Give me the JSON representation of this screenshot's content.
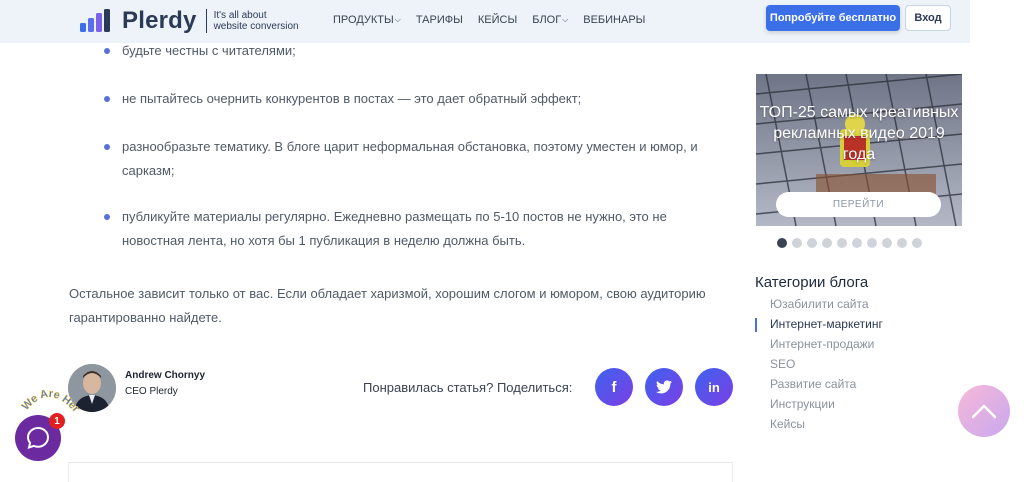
{
  "header": {
    "brand": "Plerdy",
    "tagline_line1": "It's all about",
    "tagline_line2": "website conversion",
    "nav": [
      {
        "label": "ПРОДУКТЫ",
        "has_dropdown": true
      },
      {
        "label": "ТАРИФЫ",
        "has_dropdown": false
      },
      {
        "label": "КЕЙСЫ",
        "has_dropdown": false
      },
      {
        "label": "БЛОГ",
        "has_dropdown": true
      },
      {
        "label": "ВЕБИНАРЫ",
        "has_dropdown": false
      }
    ],
    "cta_label": "Попробуйте бесплатно",
    "login_label": "Вход"
  },
  "article": {
    "bullets": [
      "будьте честны с читателями;",
      "не пытайтесь очернить конкурентов в постах — это дает обратный эффект;",
      "разнообразьте тематику. В блоге царит неформальная обстановка, поэтому уместен и юмор, и сарказм;",
      "публикуйте материалы регулярно. Ежедневно размещать по 5-10 постов не нужно, это не новостная лента, но хотя бы 1 публикация в неделю должна быть."
    ],
    "closing_paragraph": "Остальное зависит только от вас. Если обладает харизмой, хорошим слогом и юмором, свою аудиторию гарантированно найдете."
  },
  "author": {
    "name": "Andrew Chornyy",
    "role": "CEO Plerdy"
  },
  "share": {
    "label": "Понравилась статья? Поделиться:",
    "buttons": [
      {
        "icon": "facebook-icon",
        "glyph": "f"
      },
      {
        "icon": "twitter-icon",
        "glyph": ""
      },
      {
        "icon": "linkedin-icon",
        "glyph": "in"
      }
    ]
  },
  "sidebar": {
    "banner_title": "ТОП-25 самых креативных рекламных видео 2019 года",
    "banner_button": "ПЕРЕЙТИ",
    "carousel_total": 10,
    "carousel_active": 1,
    "categories_title": "Категории блога",
    "categories": [
      {
        "label": "Юзабилити сайта",
        "active": false
      },
      {
        "label": "Интернет-маркетинг",
        "active": true
      },
      {
        "label": "Интернет-продажи",
        "active": false
      },
      {
        "label": "SEO",
        "active": false
      },
      {
        "label": "Развитие сайта",
        "active": false
      },
      {
        "label": "Инструкции",
        "active": false
      },
      {
        "label": "Кейсы",
        "active": false
      }
    ]
  },
  "chat": {
    "badge_count": "1",
    "bubble_text": "We Are Here!"
  },
  "colors": {
    "accent": "#3a6fe8",
    "bullet_dot": "#5b6fd8",
    "chat": "#6b2a9f"
  }
}
